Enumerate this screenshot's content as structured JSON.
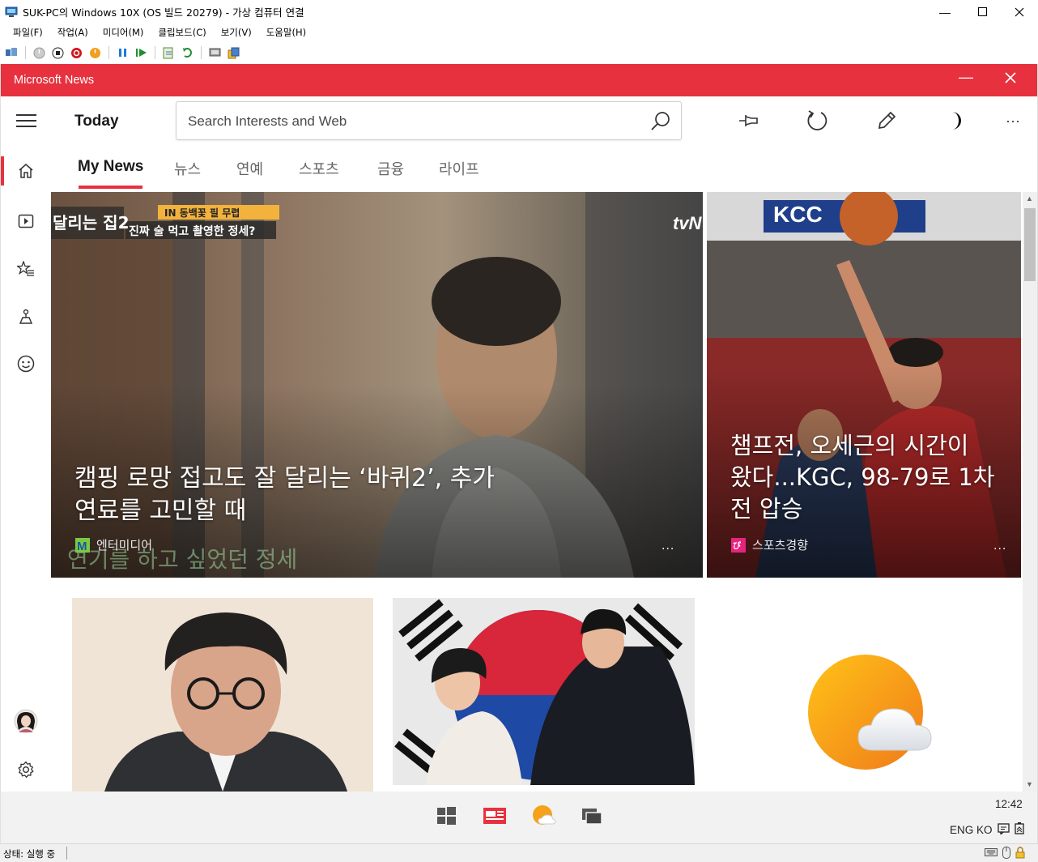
{
  "host": {
    "title": "SUK-PC의 Windows 10X (OS 빌드 20279) - 가상 컴퓨터 연결",
    "menu": [
      "파일(F)",
      "작업(A)",
      "미디어(M)",
      "클립보드(C)",
      "보기(V)",
      "도움말(H)"
    ],
    "status": "상태: 실행 중"
  },
  "app": {
    "name": "Microsoft News",
    "header_title": "Today",
    "search_placeholder": "Search Interests and Web",
    "tabs": [
      "My News",
      "뉴스",
      "연예",
      "스포츠",
      "금융",
      "라이프"
    ],
    "accent": "#e8313f"
  },
  "feed": {
    "hero": {
      "title_line1": "캠핑 로망 접고도 잘 달리는 ‘바퀴2’, 추가",
      "title_line2": "연료를 고민할 때",
      "source": "엔터미디어",
      "more": "...",
      "caption_top1": "IN 동백꽃 필 무렵",
      "caption_top2": "진짜 술 먹고 촬영한 정세?",
      "subtitle_overlay": "연기를 하고 싶었던 정세",
      "logo_text": "tvN",
      "show_badge": "달리는 집2"
    },
    "side": {
      "title_line1": "챔프전, 오세근의 시간이",
      "title_line2": "왔다...KGC, 98-79로 1차",
      "title_line3": "전 압승",
      "source": "스포츠경향",
      "more": "...",
      "banner_text": "KCC"
    }
  },
  "taskbar": {
    "clock": "12:42",
    "tray_lang": "ENG KO"
  }
}
